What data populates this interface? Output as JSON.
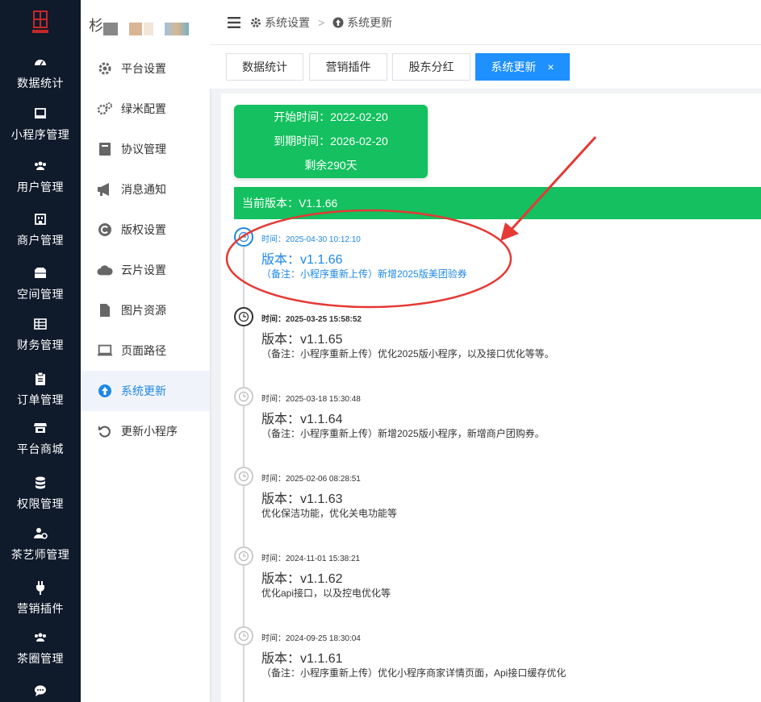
{
  "leftnav": {
    "items": [
      {
        "label": "数据统计",
        "icon": "dashboard-icon"
      },
      {
        "label": "小程序管理",
        "icon": "monitor-icon"
      },
      {
        "label": "用户管理",
        "icon": "users-icon"
      },
      {
        "label": "商户管理",
        "icon": "store-icon"
      },
      {
        "label": "空间管理",
        "icon": "box-icon"
      },
      {
        "label": "财务管理",
        "icon": "table-icon"
      },
      {
        "label": "订单管理",
        "icon": "clipboard-icon"
      },
      {
        "label": "平台商城",
        "icon": "shop-icon"
      },
      {
        "label": "权限管理",
        "icon": "database-icon"
      },
      {
        "label": "茶艺师管理",
        "icon": "user-gear-icon"
      },
      {
        "label": "营销插件",
        "icon": "plug-icon"
      },
      {
        "label": "茶圈管理",
        "icon": "group-icon"
      }
    ]
  },
  "subnav": {
    "brand": "杉",
    "items": [
      {
        "label": "平台设置",
        "icon": "gear-icon"
      },
      {
        "label": "绿米配置",
        "icon": "gears-icon"
      },
      {
        "label": "协议管理",
        "icon": "book-icon"
      },
      {
        "label": "消息通知",
        "icon": "megaphone-icon"
      },
      {
        "label": "版权设置",
        "icon": "copyright-icon"
      },
      {
        "label": "云片设置",
        "icon": "cloud-icon"
      },
      {
        "label": "图片资源",
        "icon": "file-icon"
      },
      {
        "label": "页面路径",
        "icon": "laptop-icon"
      },
      {
        "label": "系统更新",
        "icon": "upload-icon"
      },
      {
        "label": "更新小程序",
        "icon": "undo-icon"
      }
    ]
  },
  "header": {
    "crumb1": "系统设置",
    "separator": ">",
    "crumb2": "系统更新"
  },
  "tabs": [
    {
      "label": "数据统计"
    },
    {
      "label": "营销插件"
    },
    {
      "label": "股东分红"
    },
    {
      "label": "系统更新",
      "close": "×"
    }
  ],
  "license": {
    "start": "开始时间：2022-02-20",
    "end": "到期时间：2026-02-20",
    "remaining": "剩余290天"
  },
  "current_version": "当前版本：V1.1.66",
  "timeline": [
    {
      "time": "时间：2025-04-30 10:12:10",
      "version": "版本：v1.1.66",
      "note": "（备注：小程序重新上传）新增2025版美团验券"
    },
    {
      "time": "时间：2025-03-25 15:58:52",
      "version": "版本：v1.1.65",
      "note": "（备注：小程序重新上传）优化2025版小程序，以及接口优化等等。"
    },
    {
      "time": "时间：2025-03-18 15:30:48",
      "version": "版本：v1.1.64",
      "note": "（备注：小程序重新上传）新增2025版小程序，新增商户团购券。"
    },
    {
      "time": "时间：2025-02-06 08:28:51",
      "version": "版本：v1.1.63",
      "note": "优化保洁功能，优化关电功能等"
    },
    {
      "time": "时间：2024-11-01 15:38:21",
      "version": "版本：v1.1.62",
      "note": "优化api接口，以及控电优化等"
    },
    {
      "time": "时间：2024-09-25 18:30:04",
      "version": "版本：v1.1.61",
      "note": "（备注：小程序重新上传）优化小程序商家详情页面，Api接口缓存优化"
    }
  ],
  "colors": {
    "nav_bg": "#0f1a2b",
    "green": "#14c05f",
    "blue": "#1e88e5",
    "annotation_red": "#e53935"
  }
}
